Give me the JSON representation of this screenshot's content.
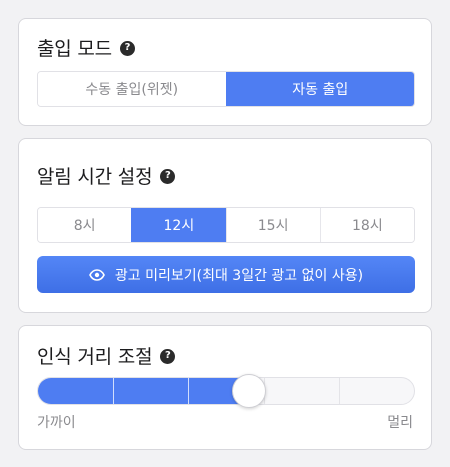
{
  "access_mode": {
    "title": "출입 모드",
    "help_icon": "question-circle-icon",
    "options": [
      "수동 출입(위젯)",
      "자동 출입"
    ],
    "selected": "자동 출입"
  },
  "notification_time": {
    "title": "알림 시간 설정",
    "help_icon": "question-circle-icon",
    "options": [
      "8시",
      "12시",
      "15시",
      "18시"
    ],
    "selected": "12시",
    "ad_button": {
      "icon": "eye-icon",
      "label": "광고 미리보기(최대 3일간 광고 없이 사용)"
    }
  },
  "recognition_distance": {
    "title": "인식 거리 조절",
    "help_icon": "question-circle-icon",
    "steps": 5,
    "level": 0.56,
    "min_label": "가까이",
    "max_label": "멀리"
  },
  "colors": {
    "accent": "#4e7df2",
    "background": "#f2f2f4",
    "card": "#ffffff",
    "text": "#1c1c1e",
    "muted": "#8a8a8e"
  }
}
